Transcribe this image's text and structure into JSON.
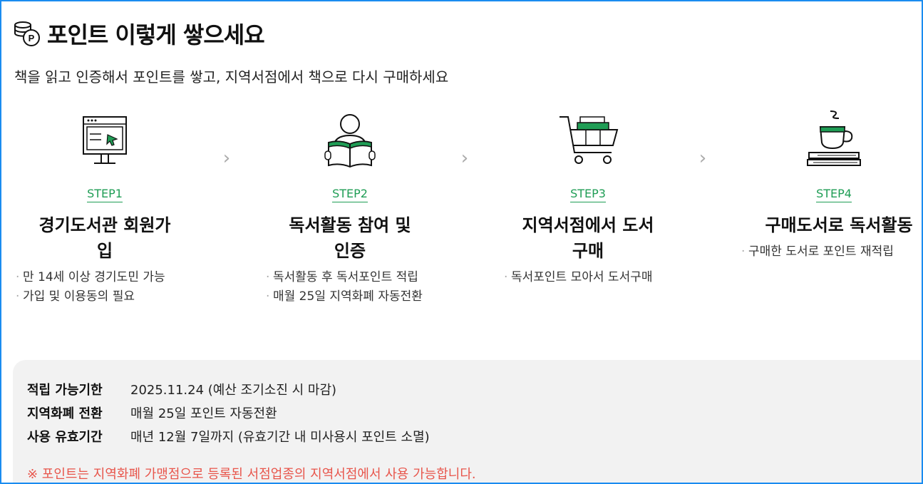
{
  "header": {
    "icon": "coins-point-icon",
    "title": "포인트 이렇게 쌓으세요",
    "subtitle": "책을 읽고 인증해서 포인트를 쌓고, 지역서점에서 책으로 다시 구매하세요"
  },
  "steps": [
    {
      "label": "STEP1",
      "name": "경기도서관 회원가입",
      "icon": "computer-monitor-icon",
      "bullets": [
        "만 14세 이상 경기도민 가능",
        "가입 및 이용동의 필요"
      ]
    },
    {
      "label": "STEP2",
      "name": "독서활동 참여 및 인증",
      "icon": "person-reading-book-icon",
      "bullets": [
        "독서활동 후 독서포인트 적립",
        "매월 25일 지역화폐 자동전환"
      ]
    },
    {
      "label": "STEP3",
      "name": "지역서점에서 도서구매",
      "icon": "shopping-cart-books-icon",
      "bullets": [
        "독서포인트 모아서 도서구매"
      ]
    },
    {
      "label": "STEP4",
      "name": "구매도서로 독서활동",
      "icon": "coffee-cup-books-icon",
      "bullets": [
        "구매한 도서로 포인트 재적립"
      ]
    }
  ],
  "info": {
    "rows": [
      {
        "key": "적립 가능기한",
        "value": "2025.11.24 (예산 조기소진 시 마감)"
      },
      {
        "key": "지역화폐 전환",
        "value": "매월 25일 포인트 자동전환"
      },
      {
        "key": "사용 유효기간",
        "value": "매년 12월 7일까지 (유효기간 내 미사용시 포인트 소멸)"
      }
    ],
    "notice": "※ 포인트는 지역화폐 가맹점으로 등록된 서점업종의 지역서점에서 사용 가능합니다."
  },
  "colors": {
    "accent_green": "#1f9d55",
    "notice_red": "#e8554b",
    "frame_blue": "#1a8cf0"
  }
}
